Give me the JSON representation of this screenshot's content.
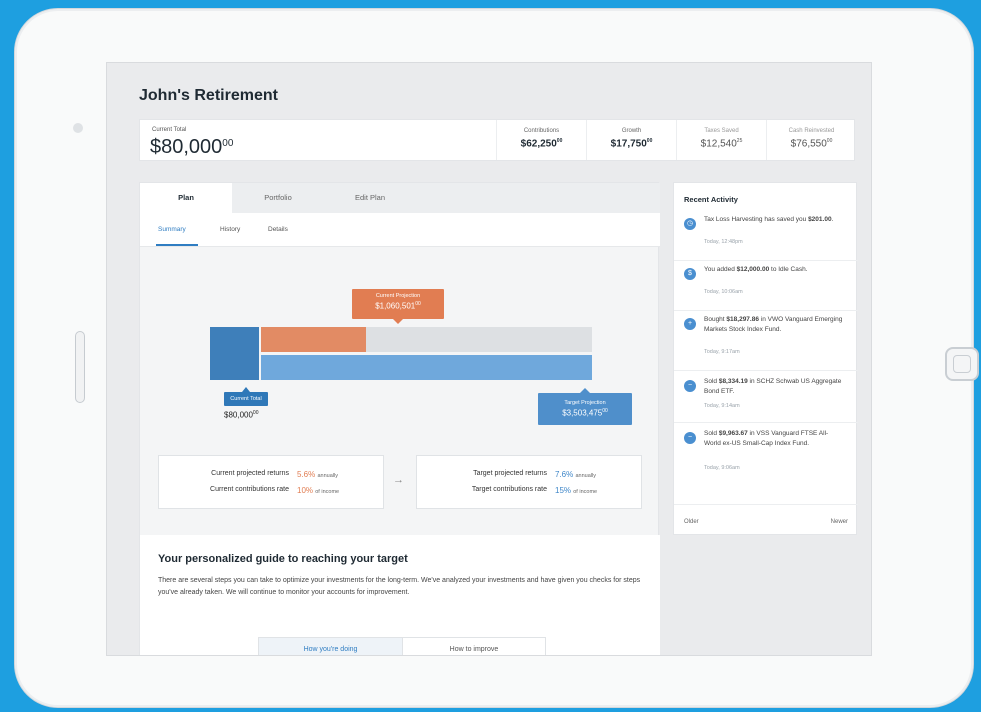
{
  "page": {
    "title": "John's Retirement"
  },
  "totals": {
    "current_total_label": "Current Total",
    "current_total_value": "$80,000",
    "current_total_cents": "00",
    "stats": [
      {
        "label": "Contributions",
        "value": "$62,250",
        "cents": "00"
      },
      {
        "label": "Growth",
        "value": "$17,750",
        "cents": "00"
      },
      {
        "label": "Taxes Saved",
        "value": "$12,540",
        "cents": "25"
      },
      {
        "label": "Cash Reinvested",
        "value": "$76,550",
        "cents": "00"
      }
    ]
  },
  "tabs": [
    "Plan",
    "Portfolio",
    "Edit Plan"
  ],
  "subtabs": [
    "Summary",
    "History",
    "Details"
  ],
  "projection": {
    "current_projection_label": "Current Projection",
    "current_projection_value": "$1,060,501",
    "current_projection_cents": "00",
    "current_total_label": "Current Total",
    "current_total_value": "$80,000",
    "current_total_cents": "00",
    "target_projection_label": "Target Projection",
    "target_projection_value": "$3,503,475",
    "target_projection_cents": "00",
    "arrow": "→"
  },
  "returns": {
    "current": [
      {
        "label": "Current projected returns",
        "value": "5.6%",
        "suffix": "annually"
      },
      {
        "label": "Current contributions rate",
        "value": "10%",
        "suffix": "of income"
      }
    ],
    "target": [
      {
        "label": "Target projected returns",
        "value": "7.6%",
        "suffix": "annually"
      },
      {
        "label": "Target contributions rate",
        "value": "15%",
        "suffix": "of income"
      }
    ]
  },
  "guide": {
    "heading": "Your personalized guide to reaching your target",
    "body": "There are several steps you can take to optimize your investments for the long-term. We've analyzed your investments and have given you checks for steps you've already taken. We will continue to monitor your accounts for improvement.",
    "tabs": [
      "How you're doing",
      "How to improve"
    ]
  },
  "activity": {
    "title": "Recent Activity",
    "items": [
      {
        "icon": "clock-icon",
        "glyph": "◷",
        "pre": "Tax Loss Harvesting has saved you ",
        "amount": "$201.00",
        "post": ".",
        "time": "Today, 12:48pm"
      },
      {
        "icon": "dollar-icon",
        "glyph": "$",
        "pre": "You added ",
        "amount": "$12,000.00",
        "post": " to Idle Cash.",
        "time": "Today, 10:06am"
      },
      {
        "icon": "plus-icon",
        "glyph": "+",
        "pre": "Bought ",
        "amount": "$18,297.86",
        "post": " in VWO Vanguard Emerging Markets Stock Index Fund.",
        "time": "Today, 9:17am"
      },
      {
        "icon": "minus-icon",
        "glyph": "−",
        "pre": "Sold ",
        "amount": "$8,334.19",
        "post": " in SCHZ Schwab US Aggregate Bond ETF.",
        "time": "Today, 9:14am"
      },
      {
        "icon": "minus-icon",
        "glyph": "−",
        "pre": "Sold ",
        "amount": "$9,963.67",
        "post": " in VSS Vanguard FTSE All-World ex-US Small-Cap Index Fund.",
        "time": "Today, 9:06am"
      }
    ],
    "older": "Older",
    "newer": "Newer"
  },
  "colors": {
    "accent_blue": "#2f7dc2",
    "accent_orange": "#e17d52",
    "background": "#1e9fe0"
  }
}
